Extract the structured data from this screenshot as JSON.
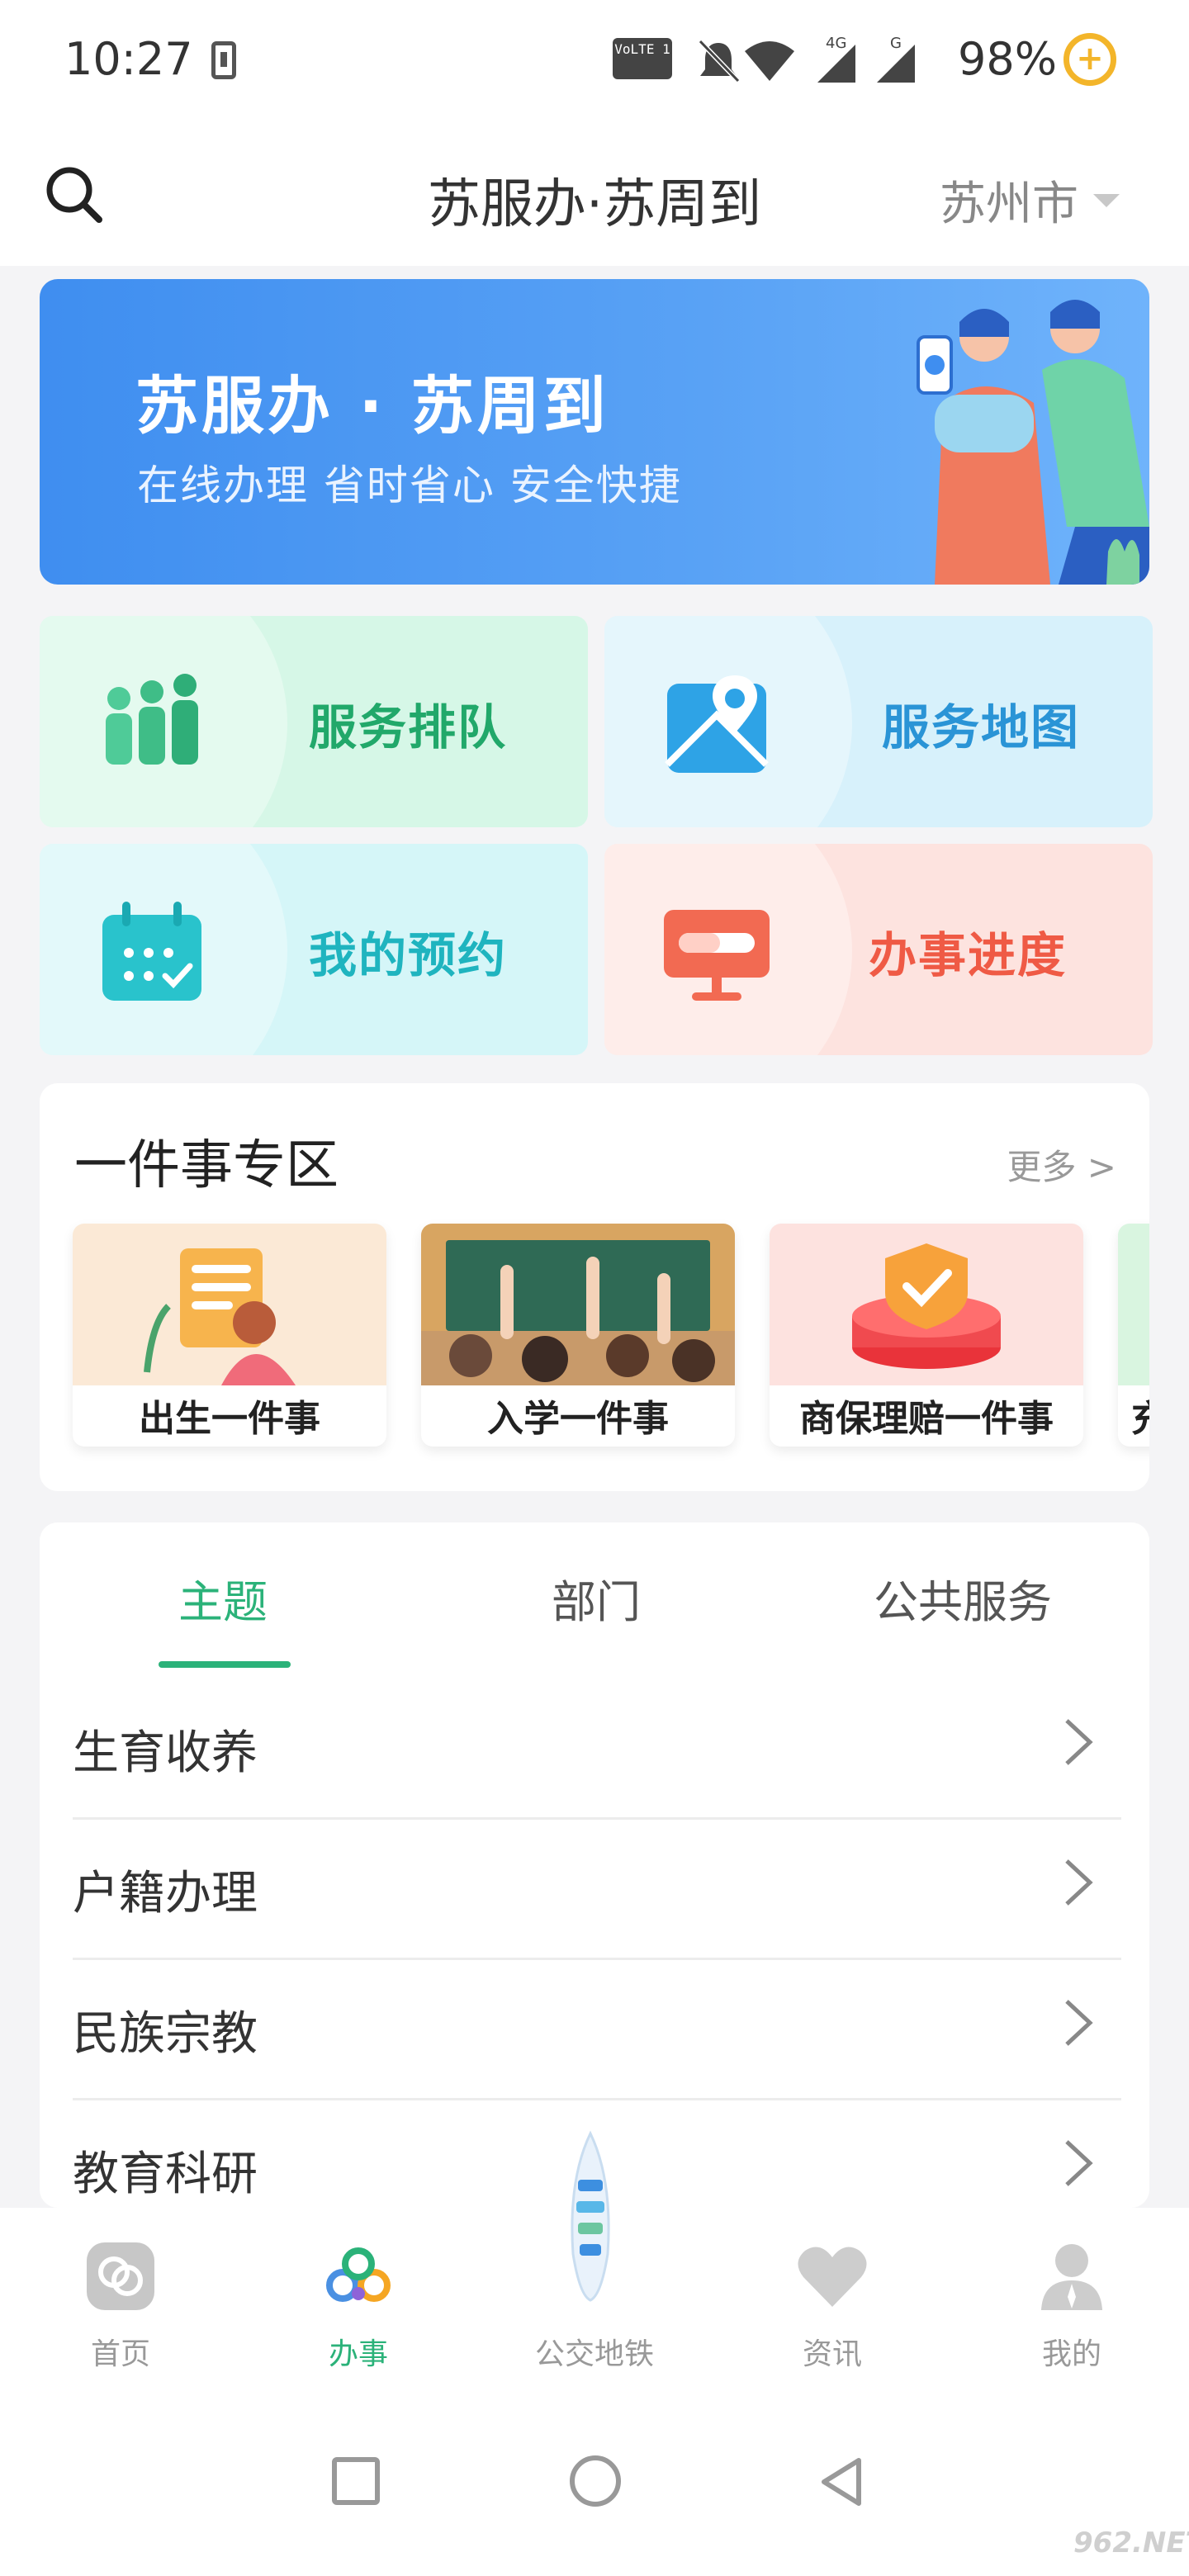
{
  "status_bar": {
    "time": "10:27",
    "volte": "VoLTE 1",
    "battery": "98%"
  },
  "header": {
    "title": "苏服办·苏周到",
    "city": "苏州市"
  },
  "banner": {
    "title": "苏服办 · 苏周到",
    "subtitle": "在线办理 省时省心 安全快捷"
  },
  "quick_tiles": [
    {
      "label": "服务排队",
      "icon": "people-queue-icon"
    },
    {
      "label": "服务地图",
      "icon": "map-pin-icon"
    },
    {
      "label": "我的预约",
      "icon": "calendar-icon"
    },
    {
      "label": "办事进度",
      "icon": "progress-monitor-icon"
    }
  ],
  "one_thing": {
    "title": "一件事专区",
    "more": "更多 >",
    "items": [
      {
        "label": "出生一件事"
      },
      {
        "label": "入学一件事"
      },
      {
        "label": "商保理赔一件事"
      },
      {
        "label": "充"
      }
    ]
  },
  "categories": {
    "tabs": [
      "主题",
      "部门",
      "公共服务"
    ],
    "active_tab": "主题",
    "items": [
      "生育收养",
      "户籍办理",
      "民族宗教",
      "教育科研"
    ]
  },
  "tabbar": {
    "items": [
      {
        "label": "首页",
        "icon": "home-icon"
      },
      {
        "label": "办事",
        "icon": "service-icon"
      },
      {
        "label": "公交地铁",
        "icon": "transit-icon"
      },
      {
        "label": "资讯",
        "icon": "heart-icon"
      },
      {
        "label": "我的",
        "icon": "person-icon"
      }
    ],
    "active": "办事"
  },
  "watermark": "962.NET",
  "colors": {
    "accent_green": "#2bb279",
    "banner_blue": "#4a96f2",
    "queue_green": "#21a86a",
    "map_blue": "#2a94d6",
    "appt_teal": "#1fb4bf",
    "progress_red": "#ef5a45"
  }
}
